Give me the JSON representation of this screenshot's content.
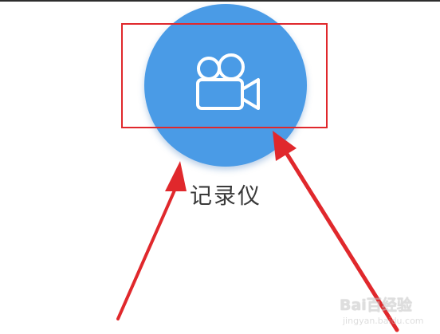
{
  "app": {
    "label": "记录仪",
    "icon": "video-camera-icon",
    "circle_color": "#4a9be6",
    "icon_color": "#ffffff"
  },
  "annotation": {
    "highlight_color": "#e0282c",
    "arrow_color": "#e0282c"
  },
  "watermark": {
    "logo_text": "Bai百经验",
    "url": "jingyan.baidu.com"
  }
}
